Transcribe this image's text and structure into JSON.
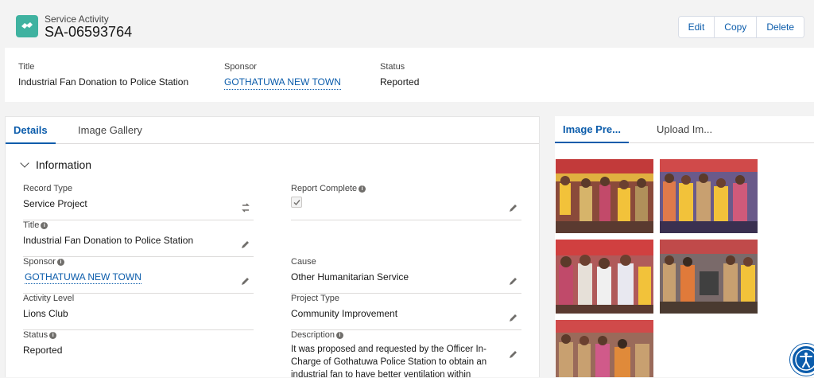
{
  "header": {
    "object_label": "Service Activity",
    "record_name": "SA-06593764",
    "actions": {
      "edit": "Edit",
      "copy": "Copy",
      "delete": "Delete"
    }
  },
  "highlights": {
    "title_label": "Title",
    "title_value": "Industrial Fan Donation to Police Station",
    "sponsor_label": "Sponsor",
    "sponsor_value": "GOTHATUWA NEW TOWN",
    "status_label": "Status",
    "status_value": "Reported"
  },
  "left_tabs": {
    "details": "Details",
    "gallery": "Image Gallery"
  },
  "section": {
    "title": "Information"
  },
  "fields": {
    "record_type": {
      "label": "Record Type",
      "value": "Service Project"
    },
    "report_complete": {
      "label": "Report Complete"
    },
    "title": {
      "label": "Title",
      "value": "Industrial Fan Donation to Police Station"
    },
    "sponsor": {
      "label": "Sponsor",
      "value": "GOTHATUWA NEW TOWN"
    },
    "cause": {
      "label": "Cause",
      "value": "Other Humanitarian Service"
    },
    "activity_level": {
      "label": "Activity Level",
      "value": "Lions Club"
    },
    "project_type": {
      "label": "Project Type",
      "value": "Community Improvement"
    },
    "status": {
      "label": "Status",
      "value": "Reported"
    },
    "description": {
      "label": "Description",
      "value": "It was proposed and requested by the Officer In-Charge of Gothatuwa Police Station to obtain an industrial fan to have better ventilation within remand"
    }
  },
  "right_tabs": {
    "preview": "Image Pre...",
    "upload": "Upload Im..."
  },
  "colors": {
    "brand": "#0b5cab",
    "object_icon": "#3fb2a0"
  }
}
